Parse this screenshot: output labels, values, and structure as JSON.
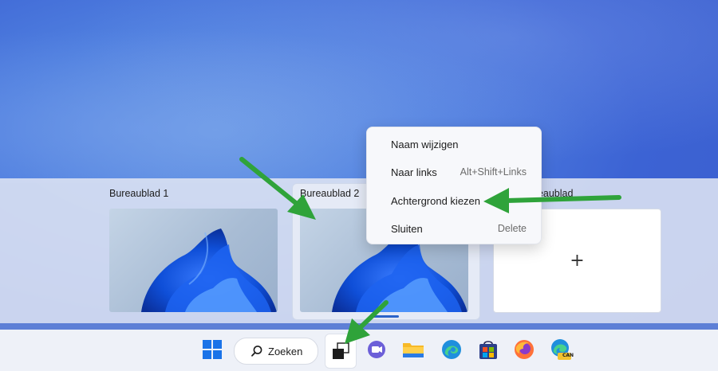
{
  "desktops": [
    {
      "label": "Bureaublad 1"
    },
    {
      "label": "Bureaublad 2"
    },
    {
      "label": "ueaublad"
    }
  ],
  "new_desktop": {
    "plus": "+"
  },
  "context_menu": {
    "items": [
      {
        "label": "Naam wijzigen",
        "shortcut": ""
      },
      {
        "label": "Naar links",
        "shortcut": "Alt+Shift+Links"
      },
      {
        "label": "Achtergrond kiezen",
        "shortcut": ""
      },
      {
        "label": "Sluiten",
        "shortcut": "Delete"
      }
    ]
  },
  "taskbar": {
    "search_label": "Zoeken",
    "icons": [
      "windows-start-icon",
      "search-icon",
      "task-view-icon",
      "teams-chat-icon",
      "file-explorer-icon",
      "edge-icon",
      "microsoft-store-icon",
      "firefox-icon",
      "edge-canary-icon"
    ],
    "canary_badge": "CAN"
  },
  "colors": {
    "accent": "#2b63c9",
    "annotation_arrow": "#2fa33a"
  }
}
